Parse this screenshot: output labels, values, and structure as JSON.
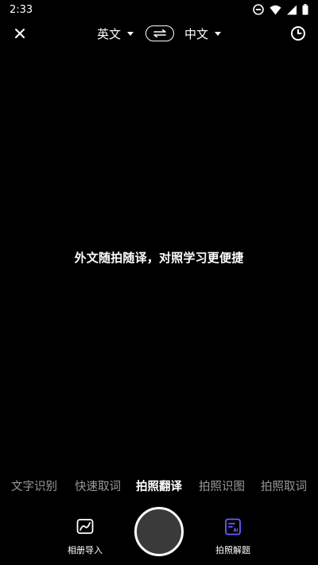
{
  "status_bar": {
    "time": "2:33",
    "icons": [
      "do-not-disturb-icon",
      "wifi-icon",
      "signal-icon",
      "battery-icon"
    ]
  },
  "toolbar": {
    "source_lang": "英文",
    "target_lang": "中文",
    "close_icon": "close-icon",
    "swap_icon": "swap-icon",
    "history_icon": "history-clock-icon"
  },
  "hint": "外文随拍随译，对照学习更便捷",
  "modes": {
    "items": [
      "文字识别",
      "快速取词",
      "拍照翻译",
      "拍照识图",
      "拍照取词"
    ],
    "active": "拍照翻译"
  },
  "bottom": {
    "album_label": "相册导入",
    "solve_label": "拍照解题",
    "accent_color": "#6b5cff"
  }
}
